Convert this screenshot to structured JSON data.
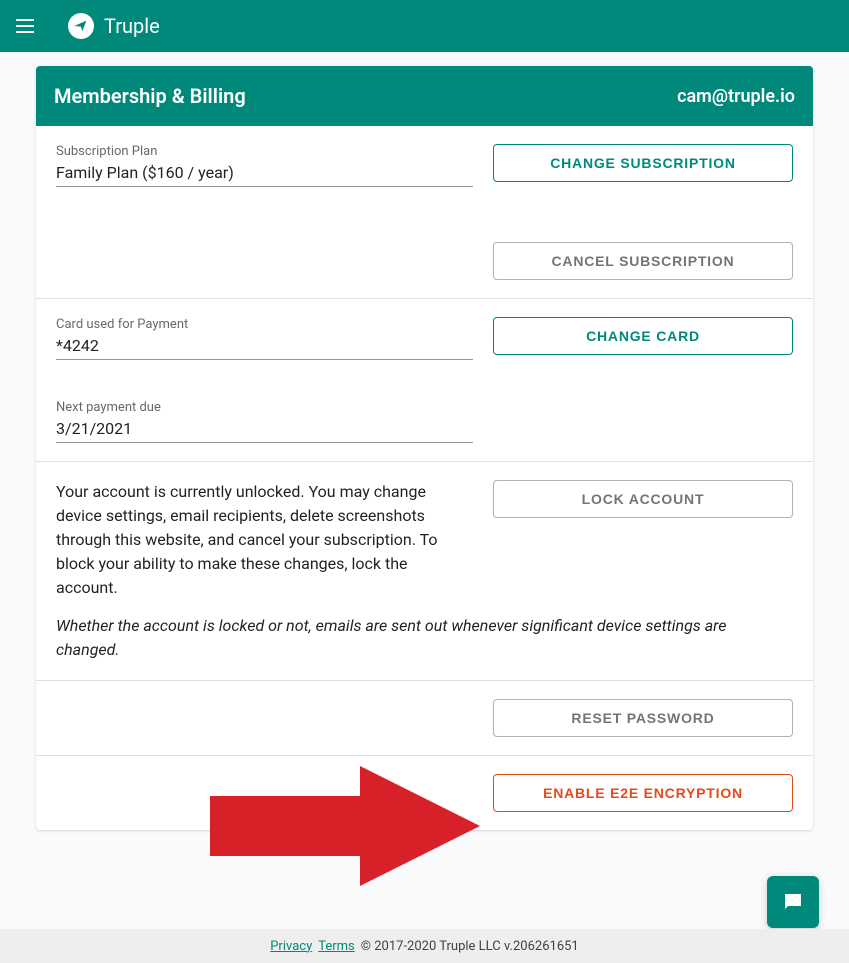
{
  "appbar": {
    "title": "Truple"
  },
  "header": {
    "title": "Membership & Billing",
    "email": "cam@truple.io"
  },
  "subscription": {
    "plan_label": "Subscription Plan",
    "plan_value": "Family Plan ($160 / year)",
    "change_btn": "CHANGE SUBSCRIPTION",
    "cancel_btn": "CANCEL SUBSCRIPTION"
  },
  "card_payment": {
    "card_label": "Card used for Payment",
    "card_value": "*4242",
    "change_card_btn": "CHANGE CARD",
    "next_label": "Next payment due",
    "next_value": "3/21/2021"
  },
  "lock": {
    "text": "Your account is currently unlocked. You may change device settings, email recipients, delete screenshots through this website, and cancel your subscription. To block your ability to make these changes, lock the account.",
    "italic": "Whether the account is locked or not, emails are sent out whenever significant device settings are changed.",
    "lock_btn": "LOCK ACCOUNT"
  },
  "reset": {
    "btn": "RESET PASSWORD"
  },
  "e2e": {
    "btn": "ENABLE E2E ENCRYPTION"
  },
  "footer": {
    "privacy": "Privacy",
    "terms": "Terms",
    "copyright": "© 2017-2020 Truple LLC  v.206261651"
  }
}
